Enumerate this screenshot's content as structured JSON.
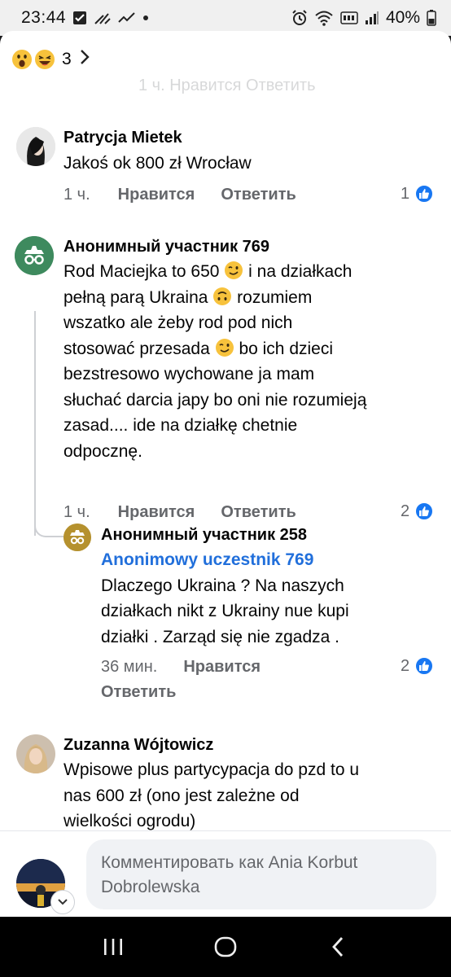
{
  "status_bar": {
    "time": "23:44",
    "battery": "40%"
  },
  "sheet": {
    "reactions_count": "3",
    "ghost_text": "1 ч.      Нравится      Ответить"
  },
  "comments": [
    {
      "author": "Patrycja Mietek",
      "text": "Jakoś ok 800 zł Wrocław",
      "time": "1 ч.",
      "like_label": "Нравится",
      "reply_label": "Ответить",
      "likes": "1"
    },
    {
      "author": "Анонимный участник 769",
      "lines": [
        "Rod Maciejka to 650",
        "i na działkach",
        "pełną parą Ukraina",
        "rozumiem",
        "wszatko ale żeby rod pod nich",
        "stosować przesada",
        "bo ich dzieci",
        "bezstresowo wychowane ja mam",
        "słuchać darcia japy bo oni nie rozumieją",
        "zasad.... ide na działkę chetnie",
        "odpocznę."
      ],
      "time": "1 ч.",
      "like_label": "Нравится",
      "reply_label": "Ответить",
      "likes": "2"
    },
    {
      "author": "Анонимный участник 258",
      "mention": "Anonimowy uczestnik 769",
      "lines": [
        "Dlaczego Ukraina ? Na naszych",
        "działkach nikt z Ukrainy nue kupi",
        "działki . Zarząd się nie zgadza ."
      ],
      "time": "36 мин.",
      "like_label": "Нравится",
      "reply_label": "Ответить",
      "likes": "2"
    },
    {
      "author": "Zuzanna Wójtowicz",
      "lines": [
        "Wpisowe plus partycypacja do pzd  to u",
        "nas 600 zł (ono jest zależne od",
        "wielkości ogrodu)"
      ]
    }
  ],
  "composer": {
    "placeholder_line1": "Комментировать как Ania Korbut",
    "placeholder_line2": "Dobrolewska"
  },
  "colors": {
    "accent": "#1877f2",
    "mention": "#216fdb",
    "meta": "#65676b",
    "anon_avatar": "#3e8a5e",
    "anon_reply_avatar": "#b5912e"
  }
}
